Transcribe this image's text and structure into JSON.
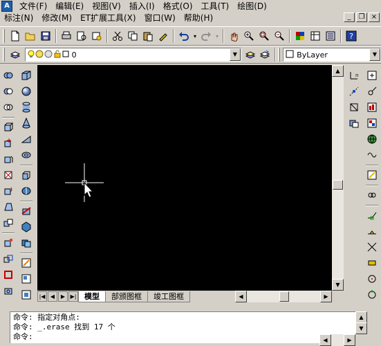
{
  "menu_row1": [
    "文件(F)",
    "编辑(E)",
    "视图(V)",
    "插入(I)",
    "格式(O)",
    "工具(T)",
    "绘图(D)"
  ],
  "menu_row2": [
    "标注(N)",
    "修改(M)",
    "ET扩展工具(X)",
    "窗口(W)",
    "帮助(H)"
  ],
  "window_controls": {
    "minimize": "_",
    "restore": "❐",
    "close": "×"
  },
  "layer": {
    "current": "0"
  },
  "linetype": {
    "value": "ByLayer"
  },
  "tabs": {
    "model": "模型",
    "layout1": "部颁图框",
    "layout2": "竣工图框"
  },
  "command": {
    "line1": "命令: 指定对角点:",
    "line2": "命令: _.erase 找到 17 个",
    "prompt": "命令:"
  },
  "colors": {
    "canvas": "#000000",
    "chrome": "#d4d0c8",
    "crosshair": "#ffffff"
  },
  "icons": {
    "standard": [
      "new-file-icon",
      "open-icon",
      "save-icon",
      "print-icon",
      "preview-icon",
      "publish-icon",
      "cut-icon",
      "copy-icon",
      "paste-icon",
      "match-properties-icon",
      "undo-icon",
      "redo-icon",
      "pan-icon",
      "zoom-realtime-icon",
      "zoom-window-icon",
      "zoom-previous-icon",
      "properties-icon",
      "designcenter-icon",
      "tool-palettes-icon",
      "help-icon"
    ]
  }
}
